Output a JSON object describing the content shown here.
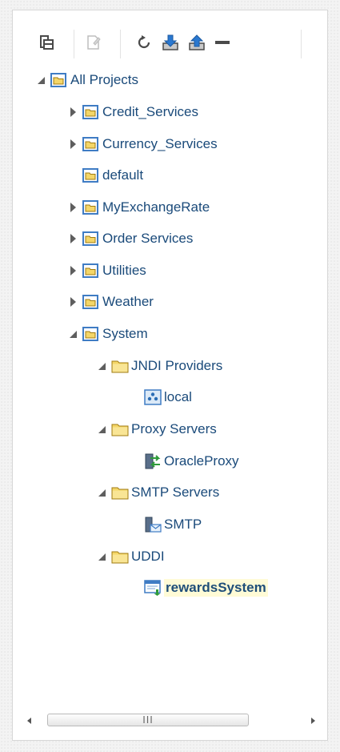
{
  "toolbar": {
    "buttons": [
      {
        "name": "collapse-all-icon",
        "enabled": true
      },
      {
        "name": "edit-icon",
        "enabled": false
      },
      {
        "name": "refresh-icon",
        "enabled": true
      },
      {
        "name": "import-icon",
        "enabled": true
      },
      {
        "name": "export-icon",
        "enabled": true
      },
      {
        "name": "delete-icon",
        "enabled": true
      }
    ]
  },
  "tree": {
    "root": "All Projects",
    "projects": [
      "Credit_Services",
      "Currency_Services",
      "default",
      "MyExchangeRate",
      "Order Services",
      "Utilities",
      "Weather",
      "System"
    ],
    "system_children": {
      "jndi_providers": {
        "label": "JNDI Providers",
        "child": "local"
      },
      "proxy_servers": {
        "label": "Proxy Servers",
        "child": "OracleProxy"
      },
      "smtp_servers": {
        "label": "SMTP Servers",
        "child": "SMTP"
      },
      "uddi": {
        "label": "UDDI",
        "child": "rewardsSystem"
      }
    },
    "selected": "rewardsSystem"
  },
  "scrollbar": {
    "grip": "III"
  },
  "colors": {
    "link_text": "#1a4a7a",
    "selection_bg": "#fffbd6",
    "folder_yellow": "#f4d668",
    "project_blue": "#3f7cc4"
  }
}
